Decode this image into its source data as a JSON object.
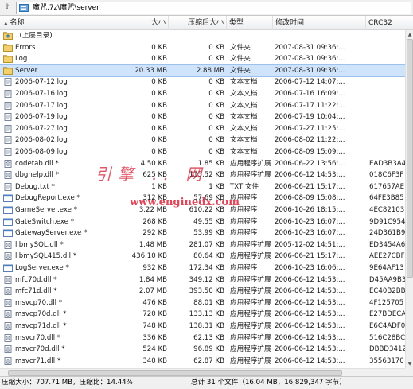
{
  "address": {
    "path": "魔咒.7z\\魔咒\\server"
  },
  "columns": [
    "名称",
    "大小",
    "压缩后大小",
    "类型",
    "修改时间",
    "CRC32"
  ],
  "rows": [
    {
      "name": "..(上层目录)",
      "size": "",
      "packed": "",
      "type": "",
      "modified": "",
      "crc": "",
      "icon": "folder-up-icon"
    },
    {
      "name": "Errors",
      "size": "0 KB",
      "packed": "0 KB",
      "type": "文件夹",
      "modified": "2007-08-31 09:36:...",
      "crc": "",
      "icon": "folder-icon"
    },
    {
      "name": "Log",
      "size": "0 KB",
      "packed": "0 KB",
      "type": "文件夹",
      "modified": "2007-08-31 09:36:...",
      "crc": "",
      "icon": "folder-icon"
    },
    {
      "name": "Server",
      "size": "20.33 MB",
      "packed": "2.88 MB",
      "type": "文件夹",
      "modified": "2007-08-31 09:36:...",
      "crc": "",
      "icon": "folder-icon"
    },
    {
      "name": "2006-07-12.log",
      "size": "0 KB",
      "packed": "0 KB",
      "type": "文本文档",
      "modified": "2006-07-12 14:07:...",
      "crc": "",
      "icon": "text-file-icon"
    },
    {
      "name": "2006-07-16.log",
      "size": "0 KB",
      "packed": "0 KB",
      "type": "文本文档",
      "modified": "2006-07-16 16:09:...",
      "crc": "",
      "icon": "text-file-icon"
    },
    {
      "name": "2006-07-17.log",
      "size": "0 KB",
      "packed": "0 KB",
      "type": "文本文档",
      "modified": "2006-07-17 11:22:...",
      "crc": "",
      "icon": "text-file-icon"
    },
    {
      "name": "2006-07-19.log",
      "size": "0 KB",
      "packed": "0 KB",
      "type": "文本文档",
      "modified": "2006-07-19 10:04:...",
      "crc": "",
      "icon": "text-file-icon"
    },
    {
      "name": "2006-07-27.log",
      "size": "0 KB",
      "packed": "0 KB",
      "type": "文本文档",
      "modified": "2006-07-27 11:25:...",
      "crc": "",
      "icon": "text-file-icon"
    },
    {
      "name": "2006-08-02.log",
      "size": "0 KB",
      "packed": "0 KB",
      "type": "文本文档",
      "modified": "2006-08-02 11:22:...",
      "crc": "",
      "icon": "text-file-icon"
    },
    {
      "name": "2006-08-09.log",
      "size": "0 KB",
      "packed": "0 KB",
      "type": "文本文档",
      "modified": "2006-08-09 15:09:...",
      "crc": "",
      "icon": "text-file-icon"
    },
    {
      "name": "codetab.dll *",
      "size": "4.50 KB",
      "packed": "1.85 KB",
      "type": "应用程序扩展",
      "modified": "2006-06-22 13:56:...",
      "crc": "EAD3B3A4",
      "icon": "dll-file-icon"
    },
    {
      "name": "dbghelp.dll *",
      "size": "625 KB",
      "packed": "115.52 KB",
      "type": "应用程序扩展",
      "modified": "2006-06-12 14:53:...",
      "crc": "018C6F3F",
      "icon": "dll-file-icon"
    },
    {
      "name": "Debug.txt *",
      "size": "1 KB",
      "packed": "1 KB",
      "type": "TXT 文件",
      "modified": "2006-06-21 15:17:...",
      "crc": "617657AE",
      "icon": "text-file-icon"
    },
    {
      "name": "DebugReport.exe *",
      "size": "312 KB",
      "packed": "57.69 KB",
      "type": "应用程序",
      "modified": "2006-08-09 15:08:...",
      "crc": "64FE3B85",
      "icon": "exe-file-icon"
    },
    {
      "name": "GameServer.exe *",
      "size": "3.22 MB",
      "packed": "610.22 KB",
      "type": "应用程序",
      "modified": "2006-10-26 18:15:...",
      "crc": "4EC82103",
      "icon": "exe-file-icon"
    },
    {
      "name": "GateSwitch.exe *",
      "size": "268 KB",
      "packed": "49.55 KB",
      "type": "应用程序",
      "modified": "2006-10-23 16:07:...",
      "crc": "9D91C954",
      "icon": "exe-file-icon"
    },
    {
      "name": "GatewayServer.exe *",
      "size": "292 KB",
      "packed": "53.99 KB",
      "type": "应用程序",
      "modified": "2006-10-23 16:07:...",
      "crc": "24D361B9",
      "icon": "exe-file-icon"
    },
    {
      "name": "libmySQL.dll *",
      "size": "1.48 MB",
      "packed": "281.07 KB",
      "type": "应用程序扩展",
      "modified": "2005-12-02 14:51:...",
      "crc": "ED3454A6",
      "icon": "dll-file-icon"
    },
    {
      "name": "libmySQL415.dll *",
      "size": "436.10 KB",
      "packed": "80.64 KB",
      "type": "应用程序扩展",
      "modified": "2006-06-21 15:17:...",
      "crc": "AEE27CBF",
      "icon": "dll-file-icon"
    },
    {
      "name": "LogServer.exe *",
      "size": "932 KB",
      "packed": "172.34 KB",
      "type": "应用程序",
      "modified": "2006-10-23 16:06:...",
      "crc": "9E64AF13",
      "icon": "exe-file-icon"
    },
    {
      "name": "mfc70d.dll *",
      "size": "1.84 MB",
      "packed": "349.12 KB",
      "type": "应用程序扩展",
      "modified": "2006-06-12 14:53:...",
      "crc": "D45AA9B3",
      "icon": "dll-file-icon"
    },
    {
      "name": "mfc71d.dll *",
      "size": "2.07 MB",
      "packed": "393.50 KB",
      "type": "应用程序扩展",
      "modified": "2006-06-12 14:53:...",
      "crc": "EC40B2BB",
      "icon": "dll-file-icon"
    },
    {
      "name": "msvcp70.dll *",
      "size": "476 KB",
      "packed": "88.01 KB",
      "type": "应用程序扩展",
      "modified": "2006-06-12 14:53:...",
      "crc": "4F125705",
      "icon": "dll-file-icon"
    },
    {
      "name": "msvcp70d.dll *",
      "size": "720 KB",
      "packed": "133.13 KB",
      "type": "应用程序扩展",
      "modified": "2006-06-12 14:53:...",
      "crc": "E27BDECA",
      "icon": "dll-file-icon"
    },
    {
      "name": "msvcp71d.dll *",
      "size": "748 KB",
      "packed": "138.31 KB",
      "type": "应用程序扩展",
      "modified": "2006-06-12 14:53:...",
      "crc": "E6C4ADF0",
      "icon": "dll-file-icon"
    },
    {
      "name": "msvcr70.dll *",
      "size": "336 KB",
      "packed": "62.13 KB",
      "type": "应用程序扩展",
      "modified": "2006-06-12 14:53:...",
      "crc": "516C28BC",
      "icon": "dll-file-icon"
    },
    {
      "name": "msvcr70d.dll *",
      "size": "524 KB",
      "packed": "96.89 KB",
      "type": "应用程序扩展",
      "modified": "2006-06-12 14:53:...",
      "crc": "DBBD3412",
      "icon": "dll-file-icon"
    },
    {
      "name": "msvcr71.dll *",
      "size": "340 KB",
      "packed": "62.87 KB",
      "type": "应用程序扩展",
      "modified": "2006-06-12 14:53:...",
      "crc": "35563170",
      "icon": "dll-file-icon"
    }
  ],
  "selected_row": 3,
  "status": {
    "left": "压缩大小：707.71 MB，压缩比：14.44%",
    "right": "总计 31 个文件（16.04 MB，16,829,347 字节）"
  },
  "watermark": {
    "chinese": "引擎 .. 网",
    "url": "www.enginedx.com"
  },
  "colors": {
    "selection": "#cfe3fb",
    "folder": "#e8c35a",
    "watermark": "#d6283c"
  }
}
